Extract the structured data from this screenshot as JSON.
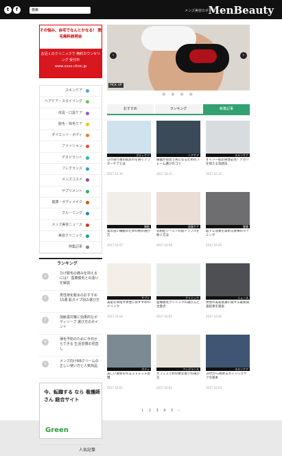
{
  "header": {
    "logo": "MenBeauty",
    "tagline": "メンズ美容のポータル",
    "search_button": "検索",
    "search_placeholder": ""
  },
  "sidebar": {
    "ad1": {
      "top_text": "その悩み、自宅でなんとかなる！ 脱毛無料説明会",
      "bottom_text": "お近くのクリニックで 無料カウンセリング 受付中",
      "url": "www.xxxx-clinic.jp"
    },
    "categories": [
      {
        "label": "スキンケア",
        "color": "#4aa3df"
      },
      {
        "label": "ヘアケア・スタイリング",
        "color": "#6bbf59"
      },
      {
        "label": "体臭・口臭ケア",
        "color": "#9b59b6"
      },
      {
        "label": "脱毛・除毛ケア",
        "color": "#f1c40f"
      },
      {
        "label": "ダイエット・ボディ",
        "color": "#e67e22"
      },
      {
        "label": "ファッション",
        "color": "#e74c3c"
      },
      {
        "label": "デオドラント",
        "color": "#1abc9c"
      },
      {
        "label": "フレグランス",
        "color": "#3498db"
      },
      {
        "label": "メンズコスメ",
        "color": "#8e44ad"
      },
      {
        "label": "サプリメント",
        "color": "#27ae60"
      },
      {
        "label": "健康・ボディメイク",
        "color": "#d35400"
      },
      {
        "label": "グルーミング",
        "color": "#2980b9"
      },
      {
        "label": "メンズ美容ニュース",
        "color": "#c0392b"
      },
      {
        "label": "美容クリニック",
        "color": "#16a085"
      },
      {
        "label": "特集記事",
        "color": "#7f8c8d"
      }
    ],
    "ranking_title": "ランキング",
    "ranking": [
      {
        "num": "1",
        "text": "ひげ脱毛の痛みを抑えるには？ 医療脱毛との違いを解説"
      },
      {
        "num": "2",
        "text": "男性用化粧水のおすすめ15選 肌タイプ別の選び方"
      },
      {
        "num": "3",
        "text": "加齢臭対策に効果的なボディソープ 選び方のポイント"
      },
      {
        "num": "4",
        "text": "薄毛予防のために今日からできる 生活習慣の見直し"
      },
      {
        "num": "5",
        "text": "メンズ向けBBクリームの 正しい使い方と人気商品"
      }
    ],
    "ad2": {
      "text": "今、転職する なら 看護師さん 総合サイト",
      "brand": "Green"
    },
    "popular_title": "人気記事"
  },
  "main": {
    "hero_label": "PICK UP",
    "tabs": [
      "新着記事",
      "ランキング",
      "おすすめ"
    ],
    "cards": [
      {
        "cap": "スキンケア",
        "title": "オイリー肌の男性必見！テカリを抑える洗顔法",
        "meta": "2017.10.12"
      },
      {
        "cap": "ヘアケア",
        "title": "眼鏡が似合う男になるためのフレーム選びのコツ",
        "meta": "2017.10.11"
      },
      {
        "cap": "ボディケア",
        "title": "ひげ剃り後の肌荒れを防ぐアフターケアとは",
        "meta": "2017.10.10"
      },
      {
        "cap": "健康",
        "title": "筋トレ効果を高める食事のタイミング",
        "meta": "2017.10.09"
      },
      {
        "cap": "体臭ケア",
        "title": "花粉症シーズンの肌トラブルを防ぐ方法",
        "meta": "2017.10.08"
      },
      {
        "cap": "睡眠",
        "title": "質の良い睡眠のための枕の選び方",
        "meta": "2017.10.07"
      },
      {
        "cap": "ニュース",
        "title": "男性の美容意識に関する最新調査結果を発表",
        "meta": "2017.10.06"
      },
      {
        "cap": "クリニック",
        "title": "医療脱毛クリニックの選び方と注意点",
        "meta": "2017.10.05"
      },
      {
        "cap": "サプリ",
        "title": "美肌を目指す男性におすすめのドリンク",
        "meta": "2017.10.04"
      },
      {
        "cap": "スキンケア",
        "title": "30代から始めるエイジングケアの基本",
        "meta": "2017.10.03"
      },
      {
        "cap": "フレグランス",
        "title": "オフィスで好印象な香りの選び方",
        "meta": "2017.10.02"
      },
      {
        "cap": "ボディ",
        "title": "美しい姿勢を作るストレッチ習慣",
        "meta": "2017.10.01"
      }
    ],
    "pager": "1 2 3 4 5 ›"
  },
  "colors": {
    "accent": "#32a071",
    "header_bg": "#111111",
    "ad_red": "#d8171e"
  }
}
